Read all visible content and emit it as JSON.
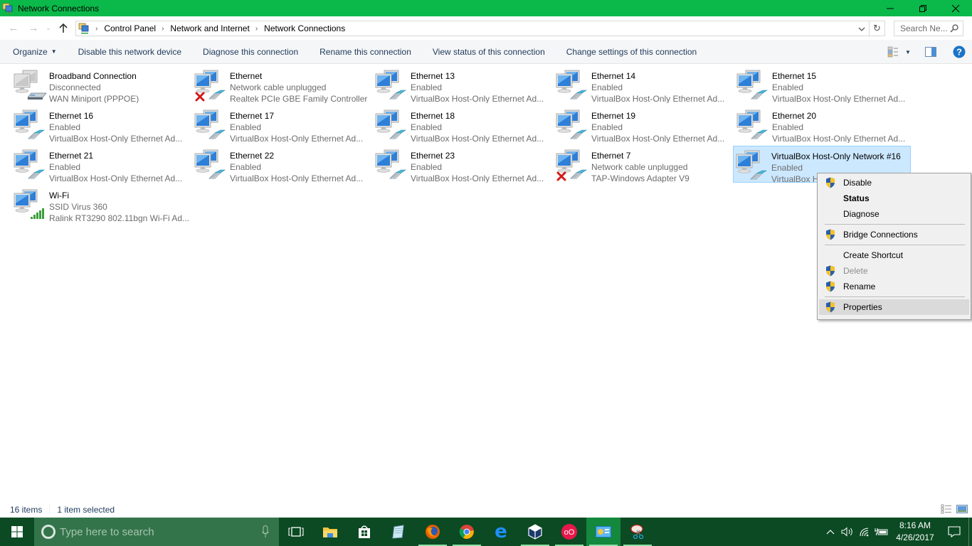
{
  "window": {
    "title": "Network Connections",
    "controls": {
      "minimize": "minimize",
      "restore": "restore",
      "close": "close"
    }
  },
  "address": {
    "breadcrumbs": [
      "Control Panel",
      "Network and Internet",
      "Network Connections"
    ],
    "search_placeholder": "Search Ne..."
  },
  "commandbar": {
    "organize": "Organize",
    "items": [
      "Disable this network device",
      "Diagnose this connection",
      "Rename this connection",
      "View status of this connection",
      "Change settings of this connection"
    ]
  },
  "connections": [
    {
      "name": "Broadband Connection",
      "status": "Disconnected",
      "device": "WAN Miniport (PPPOE)",
      "icon": "modem",
      "state": "disconnected"
    },
    {
      "name": "Ethernet",
      "status": "Network cable unplugged",
      "device": "Realtek PCIe GBE Family Controller",
      "icon": "ethernet",
      "state": "unplugged"
    },
    {
      "name": "Ethernet 13",
      "status": "Enabled",
      "device": "VirtualBox Host-Only Ethernet Ad...",
      "icon": "ethernet",
      "state": "enabled"
    },
    {
      "name": "Ethernet 14",
      "status": "Enabled",
      "device": "VirtualBox Host-Only Ethernet Ad...",
      "icon": "ethernet",
      "state": "enabled"
    },
    {
      "name": "Ethernet 15",
      "status": "Enabled",
      "device": "VirtualBox Host-Only Ethernet Ad...",
      "icon": "ethernet",
      "state": "enabled"
    },
    {
      "name": "Ethernet 16",
      "status": "Enabled",
      "device": "VirtualBox Host-Only Ethernet Ad...",
      "icon": "ethernet",
      "state": "enabled"
    },
    {
      "name": "Ethernet 17",
      "status": "Enabled",
      "device": "VirtualBox Host-Only Ethernet Ad...",
      "icon": "ethernet",
      "state": "enabled"
    },
    {
      "name": "Ethernet 18",
      "status": "Enabled",
      "device": "VirtualBox Host-Only Ethernet Ad...",
      "icon": "ethernet",
      "state": "enabled"
    },
    {
      "name": "Ethernet 19",
      "status": "Enabled",
      "device": "VirtualBox Host-Only Ethernet Ad...",
      "icon": "ethernet",
      "state": "enabled"
    },
    {
      "name": "Ethernet 20",
      "status": "Enabled",
      "device": "VirtualBox Host-Only Ethernet Ad...",
      "icon": "ethernet",
      "state": "enabled"
    },
    {
      "name": "Ethernet 21",
      "status": "Enabled",
      "device": "VirtualBox Host-Only Ethernet Ad...",
      "icon": "ethernet",
      "state": "enabled"
    },
    {
      "name": "Ethernet 22",
      "status": "Enabled",
      "device": "VirtualBox Host-Only Ethernet Ad...",
      "icon": "ethernet",
      "state": "enabled"
    },
    {
      "name": "Ethernet 23",
      "status": "Enabled",
      "device": "VirtualBox Host-Only Ethernet Ad...",
      "icon": "ethernet",
      "state": "enabled"
    },
    {
      "name": "Ethernet 7",
      "status": "Network cable unplugged",
      "device": "TAP-Windows Adapter V9",
      "icon": "ethernet",
      "state": "unplugged"
    },
    {
      "name": "VirtualBox Host-Only Network #16",
      "status": "Enabled",
      "device": "VirtualBox Host-Only Ethernet Ad...",
      "icon": "ethernet",
      "state": "enabled",
      "selected": true
    },
    {
      "name": "Wi-Fi",
      "status": "SSID Virus 360",
      "device": "Ralink RT3290 802.11bgn Wi-Fi Ad...",
      "icon": "wifi",
      "state": "connected"
    }
  ],
  "context_menu": {
    "items": [
      {
        "label": "Disable",
        "shield": true
      },
      {
        "label": "Status",
        "bold": true
      },
      {
        "label": "Diagnose"
      },
      {
        "separator": true
      },
      {
        "label": "Bridge Connections",
        "shield": true
      },
      {
        "separator": true
      },
      {
        "label": "Create Shortcut"
      },
      {
        "label": "Delete",
        "shield": true,
        "disabled": true
      },
      {
        "label": "Rename",
        "shield": true
      },
      {
        "separator": true
      },
      {
        "label": "Properties",
        "shield": true,
        "hover": true
      }
    ]
  },
  "statusbar": {
    "count": "16 items",
    "selection": "1 item selected"
  },
  "taskbar": {
    "search_placeholder": "Type here to search",
    "apps": [
      "task-view",
      "file-explorer",
      "store",
      "notepad",
      "firefox",
      "chrome",
      "edge",
      "virtualbox",
      "app-red",
      "network-connections",
      "snipping-tool"
    ],
    "clock_time": "8:16 AM",
    "clock_date": "4/26/2017"
  },
  "colors": {
    "titlebar": "#0ab94a",
    "taskbar": "#0b4a23",
    "selection_bg": "#cce8ff",
    "selection_border": "#99d1ff",
    "link_text": "#1e395b",
    "help_blue": "#1a73c8"
  }
}
